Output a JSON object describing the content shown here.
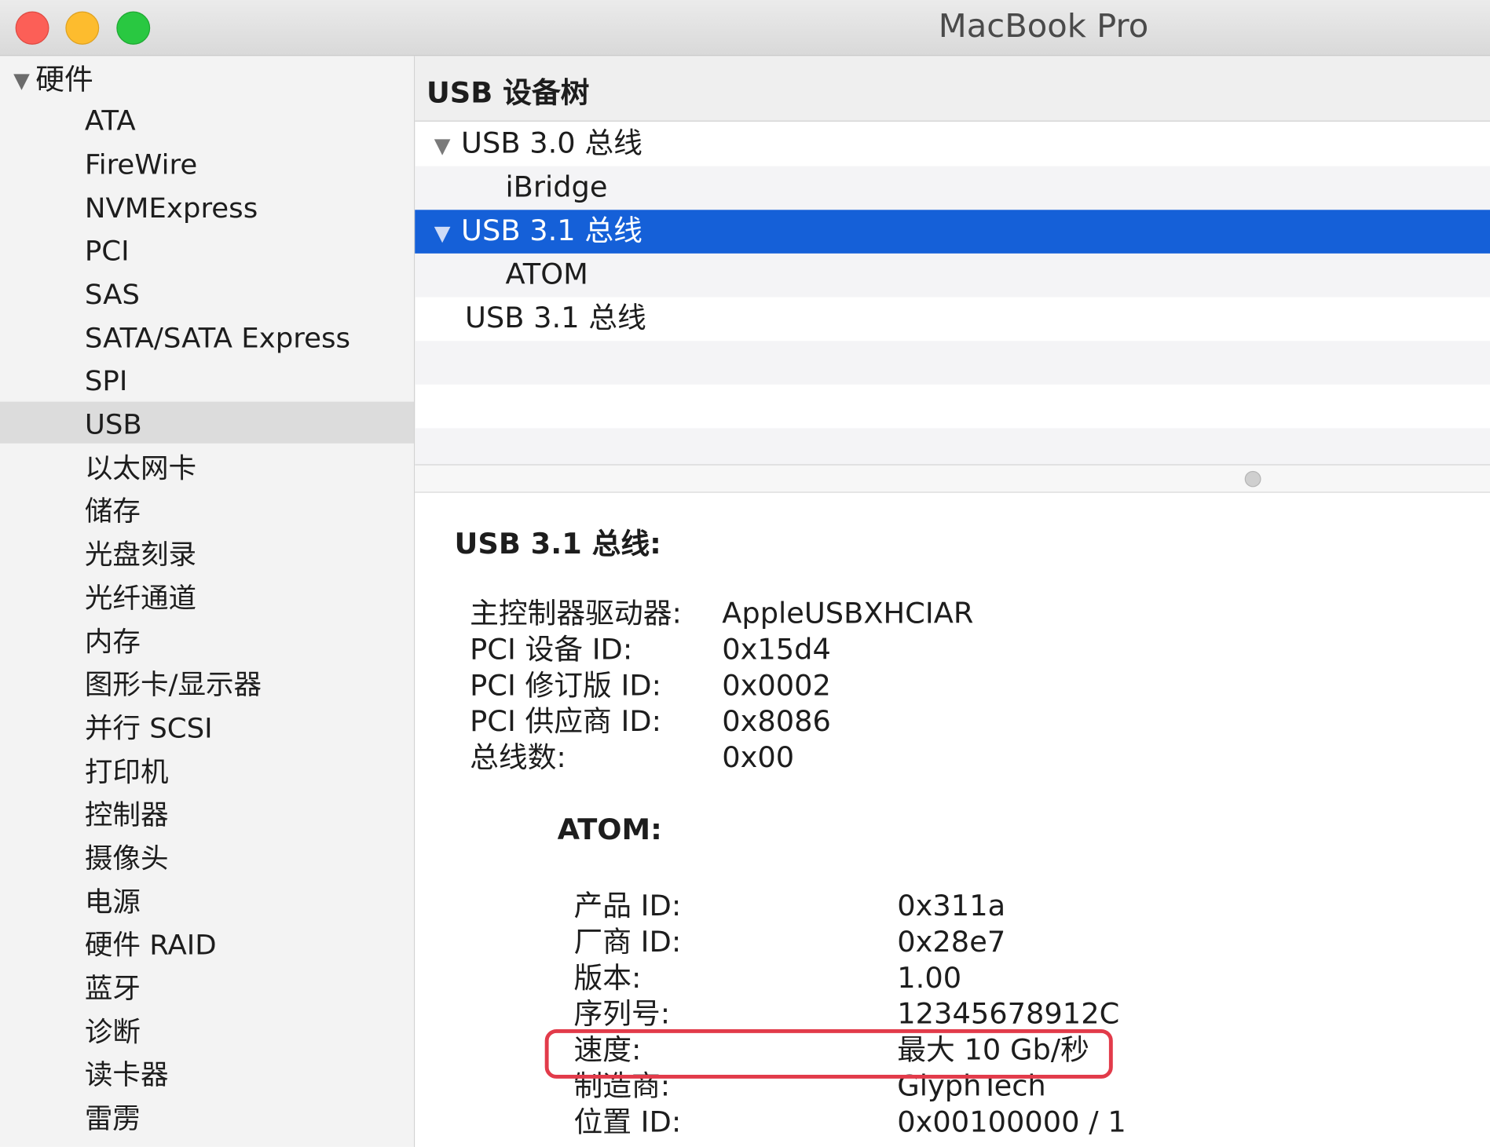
{
  "window": {
    "title": "MacBook Pro"
  },
  "sidebar": {
    "group_label": "硬件",
    "items": [
      {
        "label": "ATA"
      },
      {
        "label": "FireWire"
      },
      {
        "label": "NVMExpress"
      },
      {
        "label": "PCI"
      },
      {
        "label": "SAS"
      },
      {
        "label": "SATA/SATA Express"
      },
      {
        "label": "SPI"
      },
      {
        "label": "USB"
      },
      {
        "label": "以太网卡"
      },
      {
        "label": "储存"
      },
      {
        "label": "光盘刻录"
      },
      {
        "label": "光纤通道"
      },
      {
        "label": "内存"
      },
      {
        "label": "图形卡/显示器"
      },
      {
        "label": "并行 SCSI"
      },
      {
        "label": "打印机"
      },
      {
        "label": "控制器"
      },
      {
        "label": "摄像头"
      },
      {
        "label": "电源"
      },
      {
        "label": "硬件 RAID"
      },
      {
        "label": "蓝牙"
      },
      {
        "label": "诊断"
      },
      {
        "label": "读卡器"
      },
      {
        "label": "雷雳"
      }
    ],
    "selected": "USB"
  },
  "tree": {
    "header": "USB 设备树",
    "rows": [
      {
        "label": "USB 3.0 总线"
      },
      {
        "label": "iBridge"
      },
      {
        "label": "USB 3.1 总线"
      },
      {
        "label": "ATOM"
      },
      {
        "label": "USB 3.1 总线"
      }
    ]
  },
  "detail": {
    "title": "USB 3.1 总线:",
    "bus_props": [
      {
        "key": "主控制器驱动器:",
        "value": "AppleUSBXHCIAR"
      },
      {
        "key": "PCI 设备 ID:",
        "value": "0x15d4"
      },
      {
        "key": "PCI 修订版 ID:",
        "value": "0x0002"
      },
      {
        "key": "PCI 供应商 ID:",
        "value": "0x8086"
      },
      {
        "key": "总线数:",
        "value": "0x00"
      }
    ],
    "device_title": "ATOM:",
    "device_props": [
      {
        "key": "产品 ID:",
        "value": "0x311a"
      },
      {
        "key": "厂商 ID:",
        "value": "0x28e7"
      },
      {
        "key": "版本:",
        "value": "1.00"
      },
      {
        "key": "序列号:",
        "value": "12345678912C"
      },
      {
        "key": "速度:",
        "value": "最大 10 Gb/秒"
      },
      {
        "key": "制造商:",
        "value": "GlyphTech"
      },
      {
        "key": "位置 ID:",
        "value": "0x00100000 / 1"
      }
    ]
  },
  "colors": {
    "selection": "#1560d8",
    "highlight_box": "#e23b4a"
  }
}
